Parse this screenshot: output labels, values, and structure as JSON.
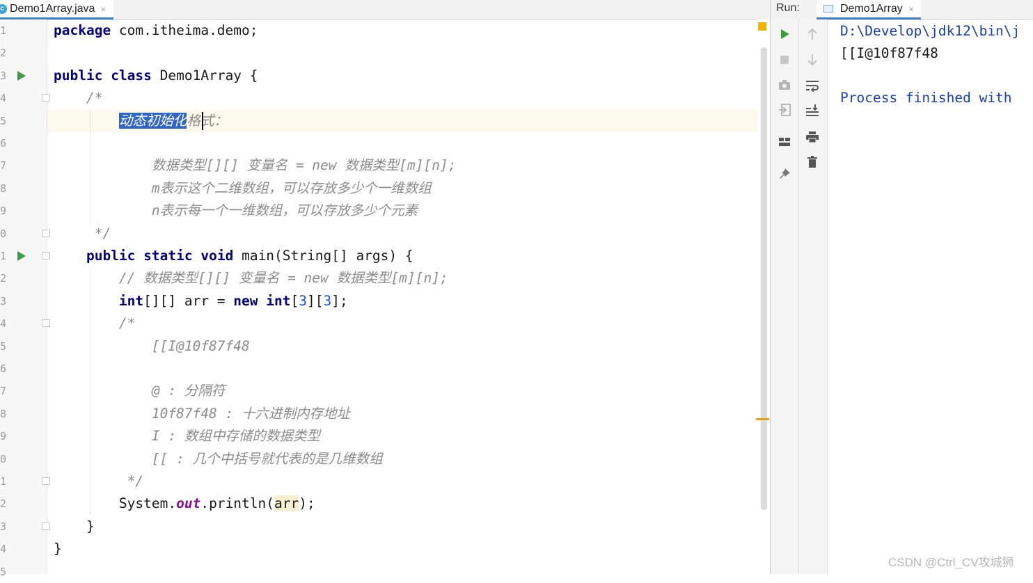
{
  "editor": {
    "tab": {
      "icon": "java-class-icon",
      "icon_glyph": "c",
      "label": "Demo1Array.java",
      "close": "×"
    },
    "line_numbers": [
      "1",
      "2",
      "3",
      "4",
      "5",
      "6",
      "7",
      "8",
      "9",
      "0",
      "1",
      "2",
      "3",
      "4",
      "5",
      "6",
      "7",
      "8",
      "9",
      "0",
      "1",
      "2",
      "3",
      "4",
      "5"
    ],
    "lines": [
      [
        {
          "t": "package",
          "c": "kw"
        },
        {
          "t": " com.itheima.demo;"
        }
      ],
      [],
      [
        {
          "t": "public",
          "c": "kw"
        },
        {
          "t": " "
        },
        {
          "t": "class",
          "c": "kw"
        },
        {
          "t": " Demo1Array {"
        }
      ],
      [
        {
          "t": "    /*",
          "c": "cm"
        }
      ],
      [
        {
          "t": "        "
        },
        {
          "t": "动态初始化",
          "c": "cm sel"
        },
        {
          "t": "格式：",
          "c": "cm"
        }
      ],
      [],
      [
        {
          "t": "            数据类型[][] 变量名 = new 数据类型[m][n];",
          "c": "cm"
        }
      ],
      [
        {
          "t": "            m表示这个二维数组，可以存放多少个一维数组",
          "c": "cm"
        }
      ],
      [
        {
          "t": "            n表示每一个一维数组，可以存放多少个元素",
          "c": "cm"
        }
      ],
      [
        {
          "t": "     */",
          "c": "cm"
        }
      ],
      [
        {
          "t": "    "
        },
        {
          "t": "public",
          "c": "kw"
        },
        {
          "t": " "
        },
        {
          "t": "static",
          "c": "kw"
        },
        {
          "t": " "
        },
        {
          "t": "void",
          "c": "kw"
        },
        {
          "t": " main(String[] args) {"
        }
      ],
      [
        {
          "t": "        "
        },
        {
          "t": "// 数据类型[][] 变量名 = new 数据类型[m][n];",
          "c": "cm"
        }
      ],
      [
        {
          "t": "        "
        },
        {
          "t": "int",
          "c": "kw"
        },
        {
          "t": "[][] arr = "
        },
        {
          "t": "new",
          "c": "kw"
        },
        {
          "t": " "
        },
        {
          "t": "int",
          "c": "kw"
        },
        {
          "t": "["
        },
        {
          "t": "3",
          "c": "num"
        },
        {
          "t": "]["
        },
        {
          "t": "3",
          "c": "num"
        },
        {
          "t": "];"
        }
      ],
      [
        {
          "t": "        /*",
          "c": "cm"
        }
      ],
      [
        {
          "t": "            [[I@10f87f48",
          "c": "cm"
        }
      ],
      [],
      [
        {
          "t": "            @ : 分隔符",
          "c": "cm"
        }
      ],
      [
        {
          "t": "            10f87f48 : 十六进制内存地址",
          "c": "cm"
        }
      ],
      [
        {
          "t": "            I : 数组中存储的数据类型",
          "c": "cm"
        }
      ],
      [
        {
          "t": "            [[ : 几个中括号就代表的是几维数组",
          "c": "cm"
        }
      ],
      [
        {
          "t": "         */",
          "c": "cm"
        }
      ],
      [
        {
          "t": "        System."
        },
        {
          "t": "out",
          "c": "fld"
        },
        {
          "t": ".println("
        },
        {
          "t": "arr",
          "c": "var-hl"
        },
        {
          "t": ");"
        }
      ],
      [
        {
          "t": "    }"
        }
      ],
      [
        {
          "t": "}"
        }
      ],
      []
    ]
  },
  "run_panel": {
    "title": "Run:",
    "tab_label": "Demo1Array",
    "tab_close": "×",
    "toolbar_left": [
      "rerun-icon",
      "stop-icon",
      "camera-icon",
      "import-icon",
      "layout-icon",
      "pin-icon"
    ],
    "toolbar_right": [
      "arrow-up-icon",
      "arrow-down-icon",
      "soft-wrap-icon",
      "scroll-to-end-icon",
      "print-icon",
      "trash-icon"
    ],
    "console": {
      "line1": "D:\\Develop\\jdk12\\bin\\j",
      "line2": "[[I@10f87f48",
      "line3": "Process finished with"
    }
  },
  "watermark": "CSDN @Ctrl_CV攻城狮",
  "colors": {
    "keyword": "#000080",
    "comment": "#8c8c8c",
    "number": "#1750eb",
    "field": "#871094",
    "selection": "#2f65ca",
    "run_green": "#3d9c40",
    "console_blue": "#1a3fb0"
  }
}
